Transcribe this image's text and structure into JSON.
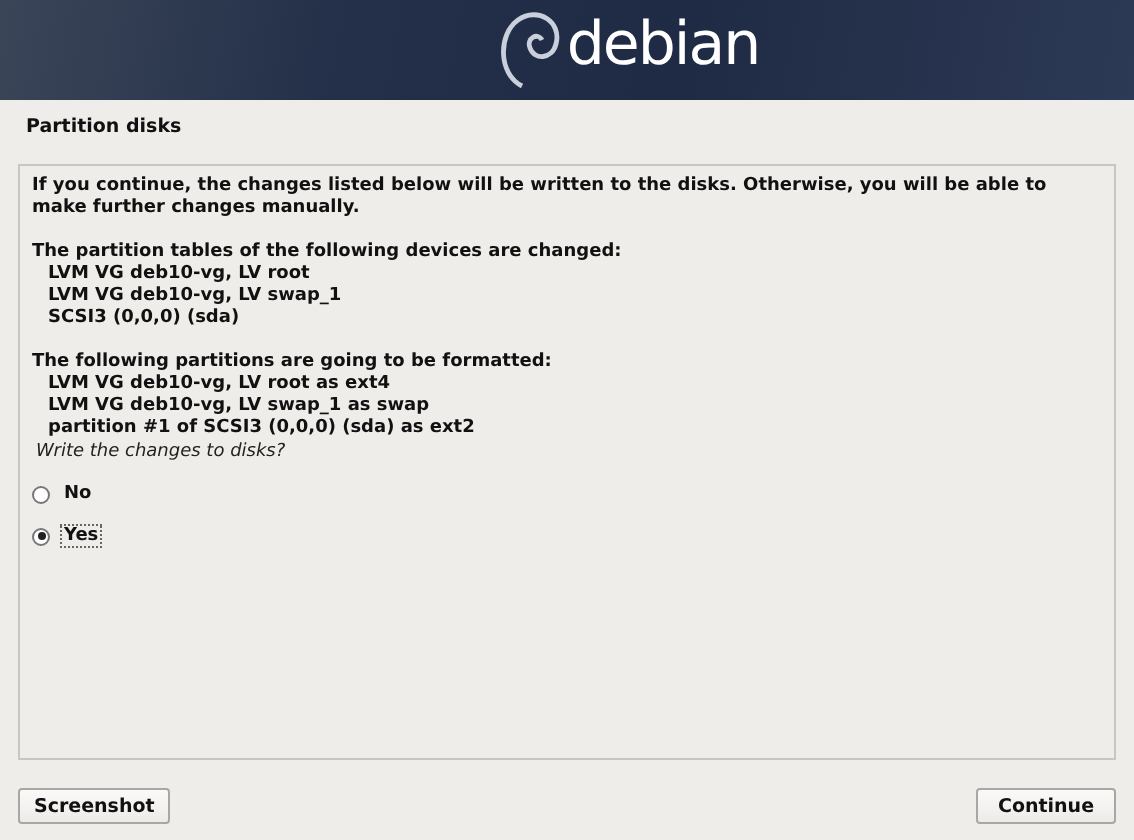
{
  "header": {
    "logo": "debian"
  },
  "title": "Partition disks",
  "panel": {
    "intro": "If you continue, the changes listed below will be written to the disks. Otherwise, you will be able to make further changes manually.",
    "sections": [
      {
        "heading": "The partition tables of the following devices are changed:",
        "items": [
          "LVM VG deb10-vg, LV root",
          "LVM VG deb10-vg, LV swap_1",
          "SCSI3 (0,0,0) (sda)"
        ]
      },
      {
        "heading": "The following partitions are going to be formatted:",
        "items": [
          "LVM VG deb10-vg, LV root as ext4",
          "LVM VG deb10-vg, LV swap_1 as swap",
          "partition #1 of SCSI3 (0,0,0) (sda) as ext2"
        ]
      }
    ],
    "question": "Write the changes to disks?",
    "options": [
      {
        "label": "No",
        "selected": false
      },
      {
        "label": "Yes",
        "selected": true
      }
    ]
  },
  "buttons": [
    {
      "label": "Screenshot",
      "kind": "left"
    },
    {
      "label": "Continue",
      "kind": "right"
    }
  ]
}
